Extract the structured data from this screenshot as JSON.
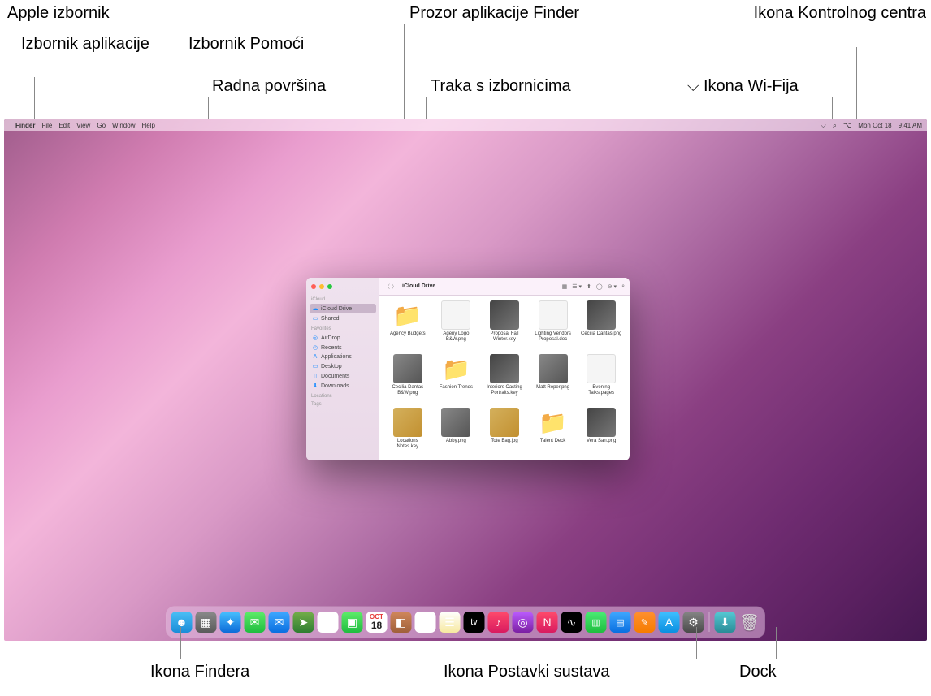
{
  "callouts": {
    "apple_menu": "Apple izbornik",
    "app_menu": "Izbornik aplikacije",
    "help_menu": "Izbornik Pomoći",
    "desktop": "Radna površina",
    "finder_window": "Prozor aplikacije Finder",
    "menu_bar": "Traka s izbornicima",
    "wifi_icon": "Ikona Wi-Fija",
    "control_center": "Ikona Kontrolnog centra",
    "finder_dock": "Ikona Findera",
    "sys_pref": "Ikona Postavki sustava",
    "dock": "Dock"
  },
  "menubar": {
    "app": "Finder",
    "items": [
      "File",
      "Edit",
      "View",
      "Go",
      "Window",
      "Help"
    ],
    "date": "Mon Oct 18",
    "time": "9:41 AM"
  },
  "finder": {
    "title": "iCloud Drive",
    "sidebar": {
      "sec1": "iCloud",
      "icloud_drive": "iCloud Drive",
      "shared": "Shared",
      "sec2": "Favorites",
      "airdrop": "AirDrop",
      "recents": "Recents",
      "apps": "Applications",
      "desktop": "Desktop",
      "docs": "Documents",
      "downloads": "Downloads",
      "sec3": "Locations",
      "sec4": "Tags"
    },
    "files": [
      {
        "name": "Agency Budgets",
        "kind": "folder"
      },
      {
        "name": "Ageny Logo B&W.png",
        "kind": "doc"
      },
      {
        "name": "Proposal Fall Winter.key",
        "kind": "img"
      },
      {
        "name": "Lighting Vendors Proposal.doc",
        "kind": "doc"
      },
      {
        "name": "Cecilia Dantas.png",
        "kind": "img"
      },
      {
        "name": "Cecilia Dantas B&W.png",
        "kind": "img3"
      },
      {
        "name": "Fashion Trends",
        "kind": "folder"
      },
      {
        "name": "Interiors Casting Portraits.key",
        "kind": "img"
      },
      {
        "name": "Matt Roper.png",
        "kind": "img3"
      },
      {
        "name": "Evening Talks.pages",
        "kind": "doc"
      },
      {
        "name": "Locations Notes.key",
        "kind": "img2"
      },
      {
        "name": "Abby.png",
        "kind": "img3"
      },
      {
        "name": "Tote Bag.jpg",
        "kind": "img2"
      },
      {
        "name": "Talent Deck",
        "kind": "folder"
      },
      {
        "name": "Vera San.png",
        "kind": "img"
      }
    ]
  },
  "dock": {
    "cal_month": "OCT",
    "cal_day": "18"
  }
}
